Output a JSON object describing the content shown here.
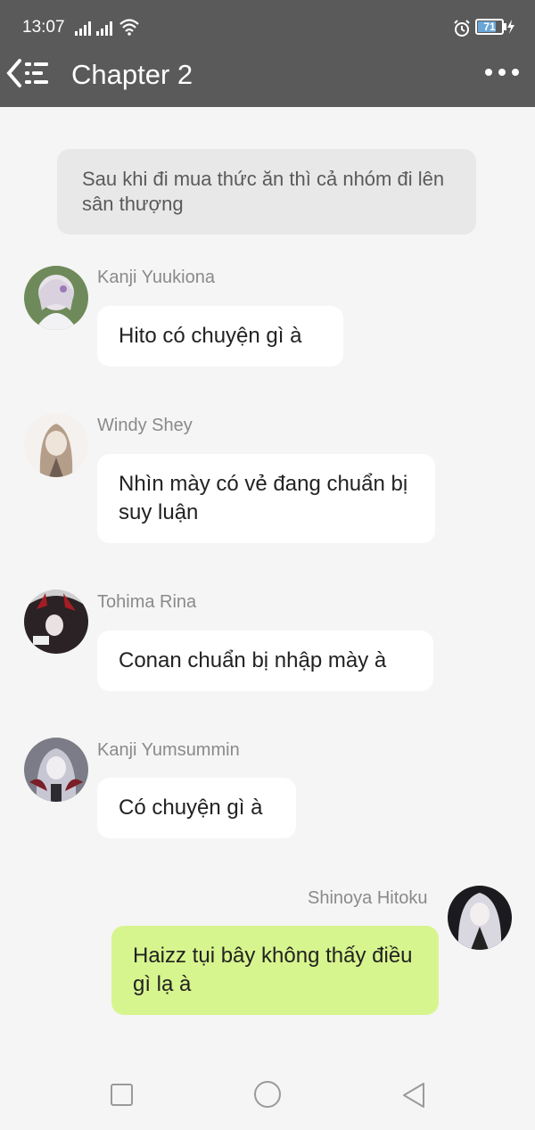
{
  "status_bar": {
    "time": "13:07",
    "battery": "71",
    "icons": [
      "signal-icon",
      "wifi-icon",
      "alarm-icon",
      "battery-icon",
      "charging-icon"
    ]
  },
  "app_bar": {
    "title": "Chapter 2",
    "back_icon": "back-list-icon",
    "more_icon": "more-icon"
  },
  "chat": {
    "narration": "Sau khi đi mua thức ăn thì cả nhóm đi lên sân thượng",
    "messages": [
      {
        "sender": "Kanji Yuukiona",
        "text": "Hito có chuyện gì à"
      },
      {
        "sender": "Windy Shey",
        "text": "Nhìn mày có vẻ đang chuẩn bị suy luận"
      },
      {
        "sender": "Tohima Rina",
        "text": "Conan chuẩn bị nhập mày à"
      },
      {
        "sender": "Kanji Yumsummin",
        "text": "Có chuyện gì à"
      },
      {
        "sender": "Shinoya Hitoku",
        "text": "Haizz tụi bây không thấy điều gì lạ à"
      }
    ]
  },
  "nav_bar": {
    "icons": [
      "recent-apps-icon",
      "home-icon",
      "back-icon"
    ]
  },
  "colors": {
    "app_bar": "#5a5a5a",
    "background": "#f5f5f5",
    "bubble_other": "#ffffff",
    "bubble_self": "#d7f58e",
    "narration": "#e8e8e8"
  }
}
